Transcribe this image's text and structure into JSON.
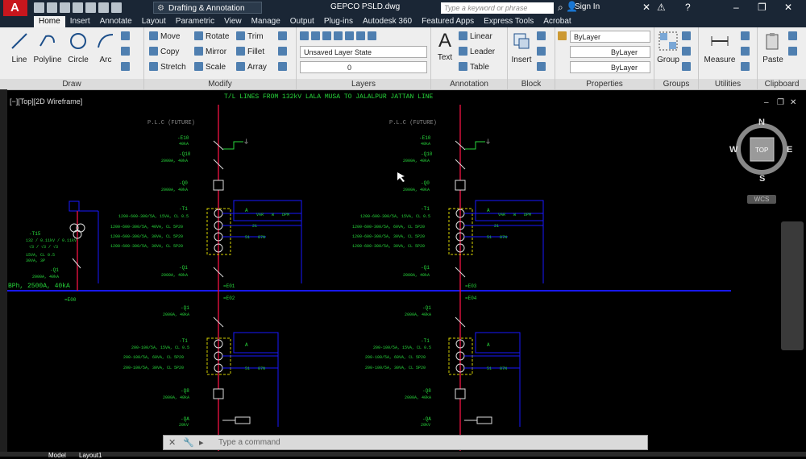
{
  "titlebar": {
    "workspace": "Drafting & Annotation",
    "file_title": "GEPCO PSLD.dwg",
    "search_placeholder": "Type a keyword or phrase",
    "sign_in": "Sign In"
  },
  "tabs": [
    "Home",
    "Insert",
    "Annotate",
    "Layout",
    "Parametric",
    "View",
    "Manage",
    "Output",
    "Plug-ins",
    "Autodesk 360",
    "Featured Apps",
    "Express Tools",
    "Acrobat"
  ],
  "ribbon": {
    "draw": {
      "title": "Draw",
      "line": "Line",
      "polyline": "Polyline",
      "circle": "Circle",
      "arc": "Arc"
    },
    "modify": {
      "title": "Modify",
      "move": "Move",
      "rotate": "Rotate",
      "trim": "Trim",
      "copy": "Copy",
      "mirror": "Mirror",
      "fillet": "Fillet",
      "stretch": "Stretch",
      "scale": "Scale",
      "array": "Array"
    },
    "layers": {
      "title": "Layers",
      "layer_state": "Unsaved Layer State",
      "current_layer": "0"
    },
    "annotation": {
      "title": "Annotation",
      "text": "Text",
      "linear": "Linear",
      "leader": "Leader",
      "table": "Table"
    },
    "block": {
      "title": "Block",
      "insert": "Insert"
    },
    "properties": {
      "title": "Properties",
      "color": "ByLayer",
      "linetype": "ByLayer",
      "lineweight": "ByLayer"
    },
    "groups": {
      "title": "Groups",
      "group": "Group"
    },
    "utilities": {
      "title": "Utilities",
      "measure": "Measure"
    },
    "clipboard": {
      "title": "Clipboard",
      "paste": "Paste"
    }
  },
  "viewport": {
    "label": "[−][Top][2D Wireframe]",
    "compass": {
      "n": "N",
      "s": "S",
      "e": "E",
      "w": "W",
      "top": "TOP",
      "wcs": "WCS"
    }
  },
  "drawing": {
    "header": "T/L LINES FROM 132kV LALA MUSA TO JALALPUR JATTAN LINE",
    "plc_left": "P.L.C (FUTURE)",
    "plc_right": "P.L.C (FUTURE)",
    "e10": "-E10",
    "e10_spec": "40kA",
    "q10": "-Q10",
    "q10_spec": "2000A, 40kA",
    "q0": "-Q0",
    "q0_spec": "2000A, 40kA",
    "t1": "-T1",
    "ct_left": [
      "1200-600-300/5A, 15VA, CL 0.5",
      "1200-600-300/5A, 40VA, CL 5P20",
      "1200-600-300/5A, 30VA, CL 5P20",
      "1200-600-300/5A, 30VA, CL 5P20"
    ],
    "ct_right": [
      "1200-600-300/5A, 15VA, CL 0.5",
      "1200-600-300/5A, 60VA, CL 5P20",
      "1200-600-300/5A, 30VA, CL 5P20",
      "1200-600-300/5A, 30VA, CL 5P20"
    ],
    "meter_a": "A",
    "meter_var": "VAR",
    "meter_w": "W",
    "meter_dpm": "DPM",
    "relay_21": "21",
    "relay_51": "51",
    "relay_87n": "87N",
    "q1": "-Q1",
    "q1_spec": "2000A, 40kA",
    "e01": "=E01",
    "e02": "=E02",
    "e03": "=E03",
    "e04": "=E04",
    "e00": "=E00",
    "busbar": "BPh, 2500A, 40kA",
    "q9": "-Q1",
    "q9_spec": "2000A, 40kA",
    "t15": "-T15",
    "t15_spec": [
      "132 / 0.11kV / 0.11kV",
      "√3 / √3 / √3",
      "15VA, CL 0.5",
      "30VA, 3P"
    ],
    "q3": "-Q1",
    "q3_spec": "2000A, 40kA",
    "ct_lower": [
      "200-100/5A, 15VA, CL 0.5",
      "200-100/5A, 60VA, CL 5P20",
      "200-100/5A, 30VA, CL 5P20"
    ],
    "q8": "-Q8",
    "q8_spec": "2000A, 40kA",
    "qa": "-QA",
    "qa_spec": "20kV"
  },
  "command": {
    "prompt": "Type a command"
  },
  "layout_tabs": {
    "model": "Model",
    "layout1": "Layout1"
  },
  "colors": {
    "bus": "#1818ff",
    "feeder": "#d2103a",
    "text_green": "#27d63b",
    "cyan": "#3ad6e0",
    "yellow": "#d6d200",
    "title_bg": "#1a2635"
  }
}
